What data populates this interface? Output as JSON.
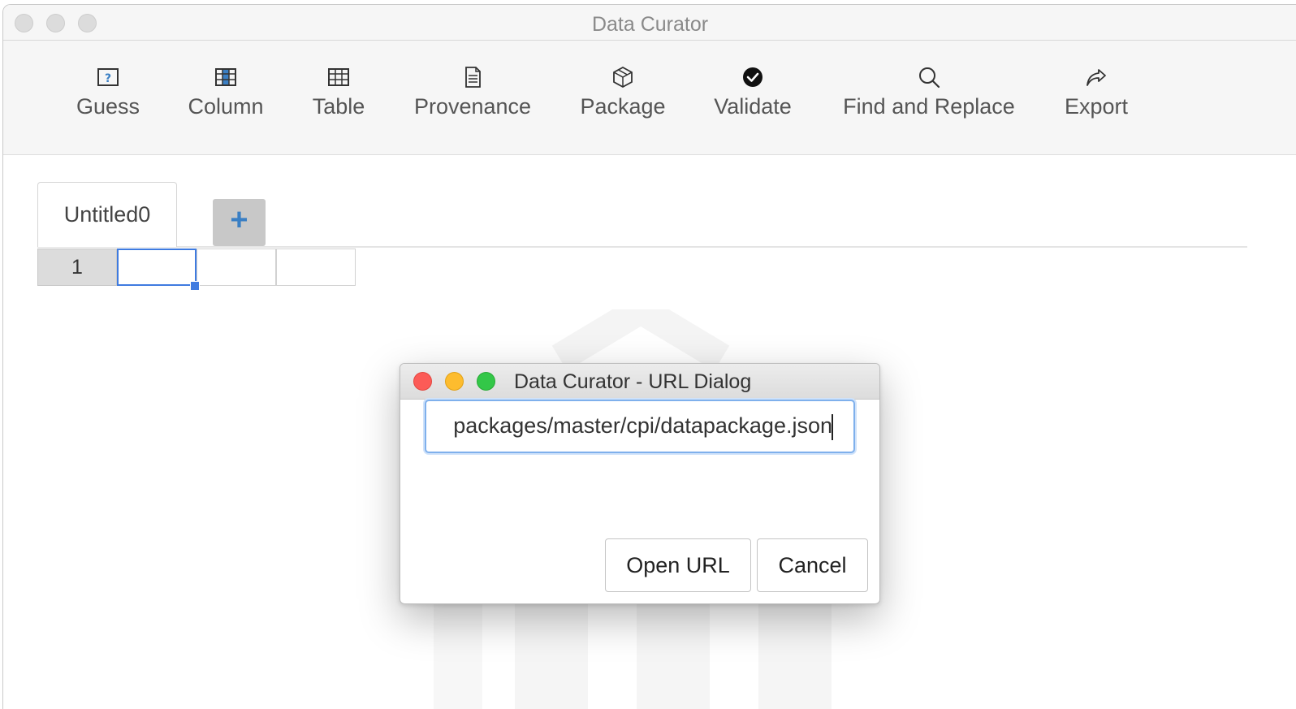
{
  "window": {
    "title": "Data Curator"
  },
  "toolbar": {
    "items": [
      {
        "label": "Guess",
        "icon": "guess-icon"
      },
      {
        "label": "Column",
        "icon": "column-icon"
      },
      {
        "label": "Table",
        "icon": "table-icon"
      },
      {
        "label": "Provenance",
        "icon": "provenance-icon"
      },
      {
        "label": "Package",
        "icon": "package-icon"
      },
      {
        "label": "Validate",
        "icon": "validate-icon"
      },
      {
        "label": "Find and Replace",
        "icon": "search-icon"
      },
      {
        "label": "Export",
        "icon": "export-icon"
      }
    ]
  },
  "tabs": {
    "items": [
      {
        "label": "Untitled0"
      }
    ],
    "add_label": "+"
  },
  "grid": {
    "row_headers": [
      "1"
    ],
    "column_count": 3
  },
  "dialog": {
    "title": "Data Curator - URL Dialog",
    "url_value": "packages/master/cpi/datapackage.json",
    "open_label": "Open URL",
    "cancel_label": "Cancel"
  },
  "colors": {
    "accent": "#3f7be0",
    "close_light": "#fc5b57",
    "minimize_light": "#fdbc2e",
    "zoom_light": "#33c748"
  }
}
